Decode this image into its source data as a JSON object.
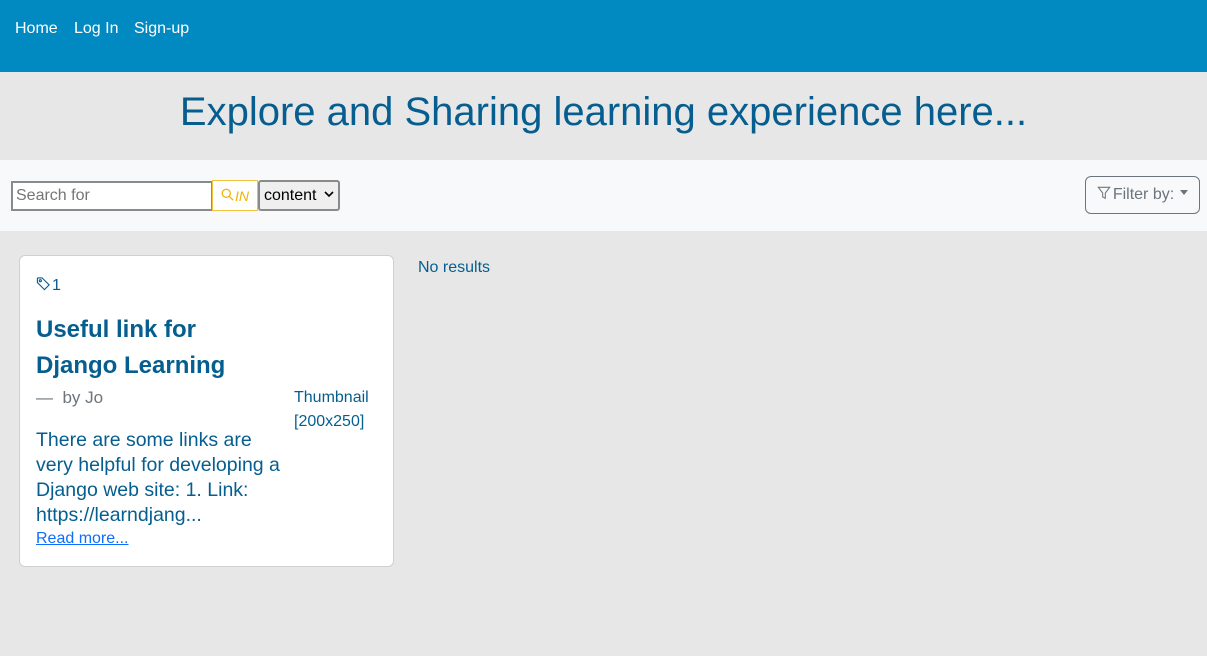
{
  "nav": {
    "items": [
      {
        "label": "Home"
      },
      {
        "label": "Log In"
      },
      {
        "label": "Sign-up"
      }
    ]
  },
  "header": {
    "title": "Explore and Sharing learning experience here..."
  },
  "search": {
    "placeholder": "Search for",
    "value": "",
    "button_label": "IN",
    "scope_selected": "content",
    "filter_label": "Filter by:"
  },
  "card": {
    "tag_count": "1",
    "title": "Useful link for Django Learning",
    "byline_dash": "—",
    "byline": "by Jo",
    "excerpt": "There are some links are very helpful for developing a Django web site: 1. Link: https://learndjang...",
    "read_more": "Read more...",
    "thumbnail_label": "Thumbnail [200x250]"
  },
  "results": {
    "empty_text": "No results"
  },
  "colors": {
    "navbar": "#0189c2",
    "title": "#055e8f",
    "background": "#e7e7e7",
    "search_button": "#f0b400"
  }
}
